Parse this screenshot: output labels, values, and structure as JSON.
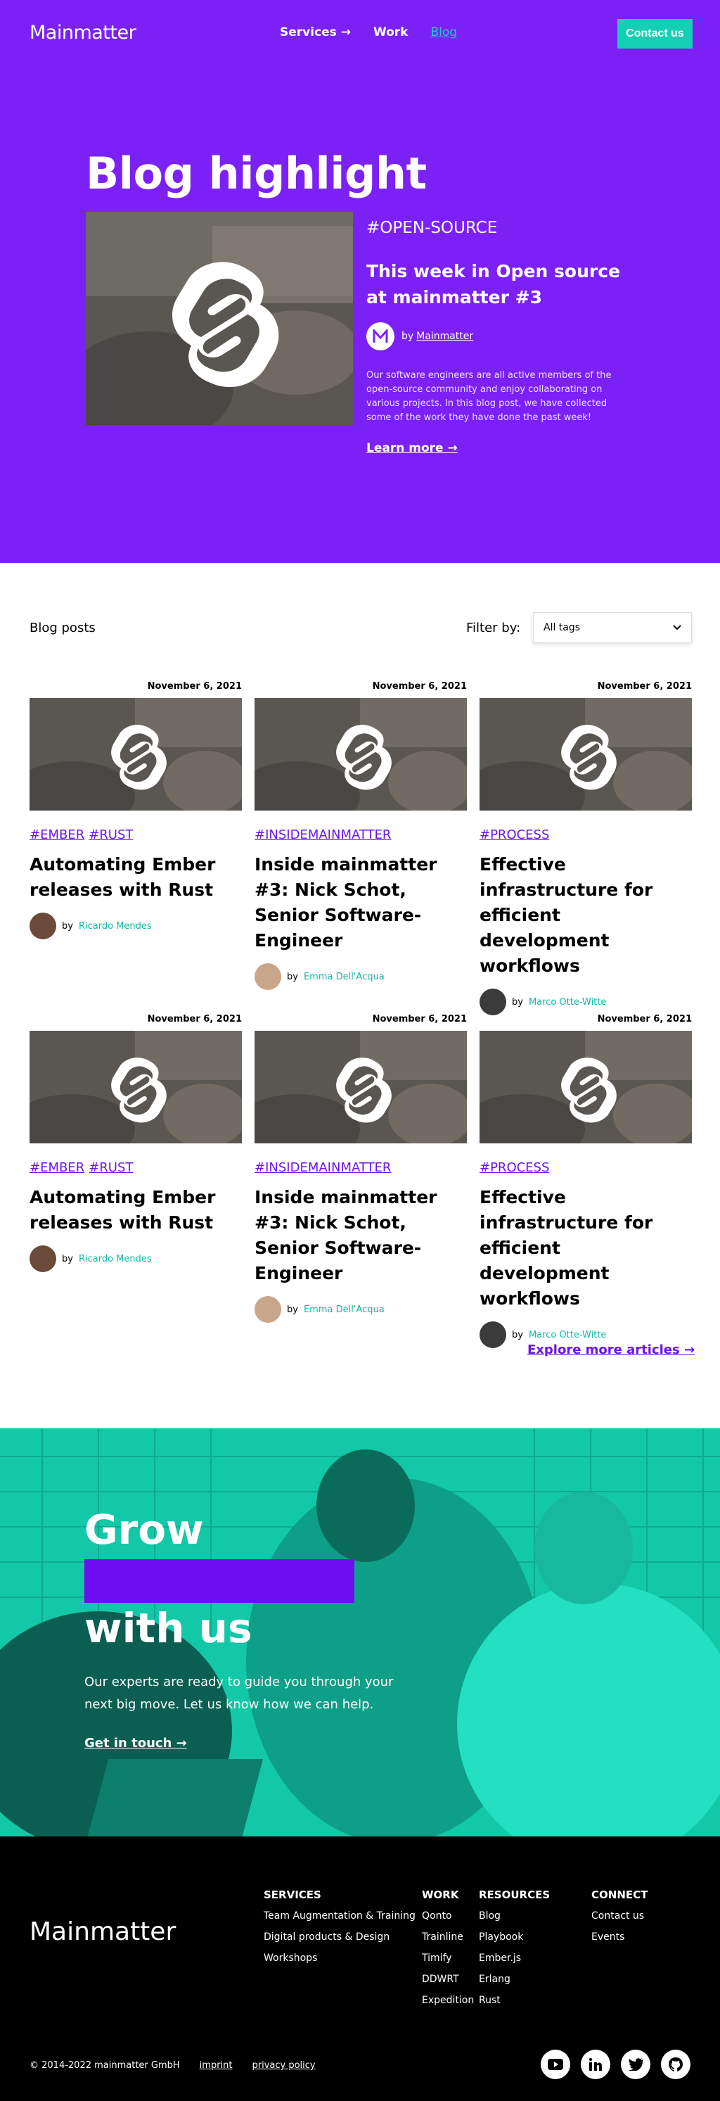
{
  "nav": {
    "logo": "Mainmatter",
    "links": [
      "Services",
      "Work",
      "Blog"
    ],
    "services_arrow": "→",
    "cta": "Contact us"
  },
  "highlight": {
    "heading": "Blog highlight",
    "tag": "#OPEN-SOURCE",
    "title": "This week in Open source at mainmatter #3",
    "by": "by",
    "author": "Mainmatter",
    "description": "Our software engineers are all active members of the open-source community and enjoy collaborating on various projects. In this blog post, we have collected some of the work they have done the past week!",
    "link": "Learn more"
  },
  "posts": {
    "heading": "Blog posts",
    "filter_label": "Filter by:",
    "filter_value": "All tags",
    "cards": [
      {
        "date": "November 6, 2021",
        "tags": [
          "#EMBER",
          "#RUST"
        ],
        "title": "Automating Ember releases with Rust",
        "by": "by",
        "author": "Ricardo Mendes"
      },
      {
        "date": "November 6, 2021",
        "tags": [
          "#INSIDEMAINMATTER"
        ],
        "title": "Inside mainmatter #3: Nick Schot, Senior Software-Engineer",
        "by": "by",
        "author": "Emma Dell'Acqua"
      },
      {
        "date": "November 6, 2021",
        "tags": [
          "#PROCESS"
        ],
        "title": "Effective infrastructure for efficient development workflows",
        "by": "by",
        "author": "Marco Otte-Witte"
      },
      {
        "date": "November 6, 2021",
        "tags": [
          "#EMBER",
          "#RUST"
        ],
        "title": "Automating Ember releases with Rust",
        "by": "by",
        "author": "Ricardo Mendes"
      },
      {
        "date": "November 6, 2021",
        "tags": [
          "#INSIDEMAINMATTER"
        ],
        "title": "Inside mainmatter #3: Nick Schot, Senior Software-Engineer",
        "by": "by",
        "author": "Emma Dell'Acqua"
      },
      {
        "date": "November 6, 2021",
        "tags": [
          "#PROCESS"
        ],
        "title": "Effective infrastructure for efficient development workflows",
        "by": "by",
        "author": "Marco Otte-Witte"
      }
    ],
    "explore": "Explore more articles"
  },
  "grow": {
    "line1": "Grow",
    "line2": "with us",
    "description": "Our experts are ready to guide you through your next big move. Let us know how we can help.",
    "link": "Get in touch"
  },
  "footer": {
    "logo": "Mainmatter",
    "columns": {
      "services": {
        "title": "SERVICES",
        "items": [
          "Team Augmentation & Training",
          "Digital products & Design",
          "Workshops"
        ]
      },
      "work": {
        "title": "WORK",
        "items": [
          "Qonto",
          "Trainline",
          "Timify",
          "DDWRT",
          "Expedition"
        ]
      },
      "resources": {
        "title": "RESOURCES",
        "items": [
          "Blog",
          "Playbook",
          "Ember.js",
          "Erlang",
          "Rust"
        ]
      },
      "connect": {
        "title": "CONNECT",
        "items": [
          "Contact us",
          "Events"
        ]
      }
    },
    "copyright": "© 2014-2022 mainmatter GmbH",
    "imprint": "imprint",
    "privacy": "privacy policy",
    "socials": [
      "youtube-icon",
      "linkedin-icon",
      "twitter-icon",
      "github-icon"
    ]
  },
  "colors": {
    "brand_purple": "#7c21f5",
    "accent_teal": "#14cfb4",
    "link_purple": "#6b15e6",
    "footer_bg": "#000000"
  }
}
